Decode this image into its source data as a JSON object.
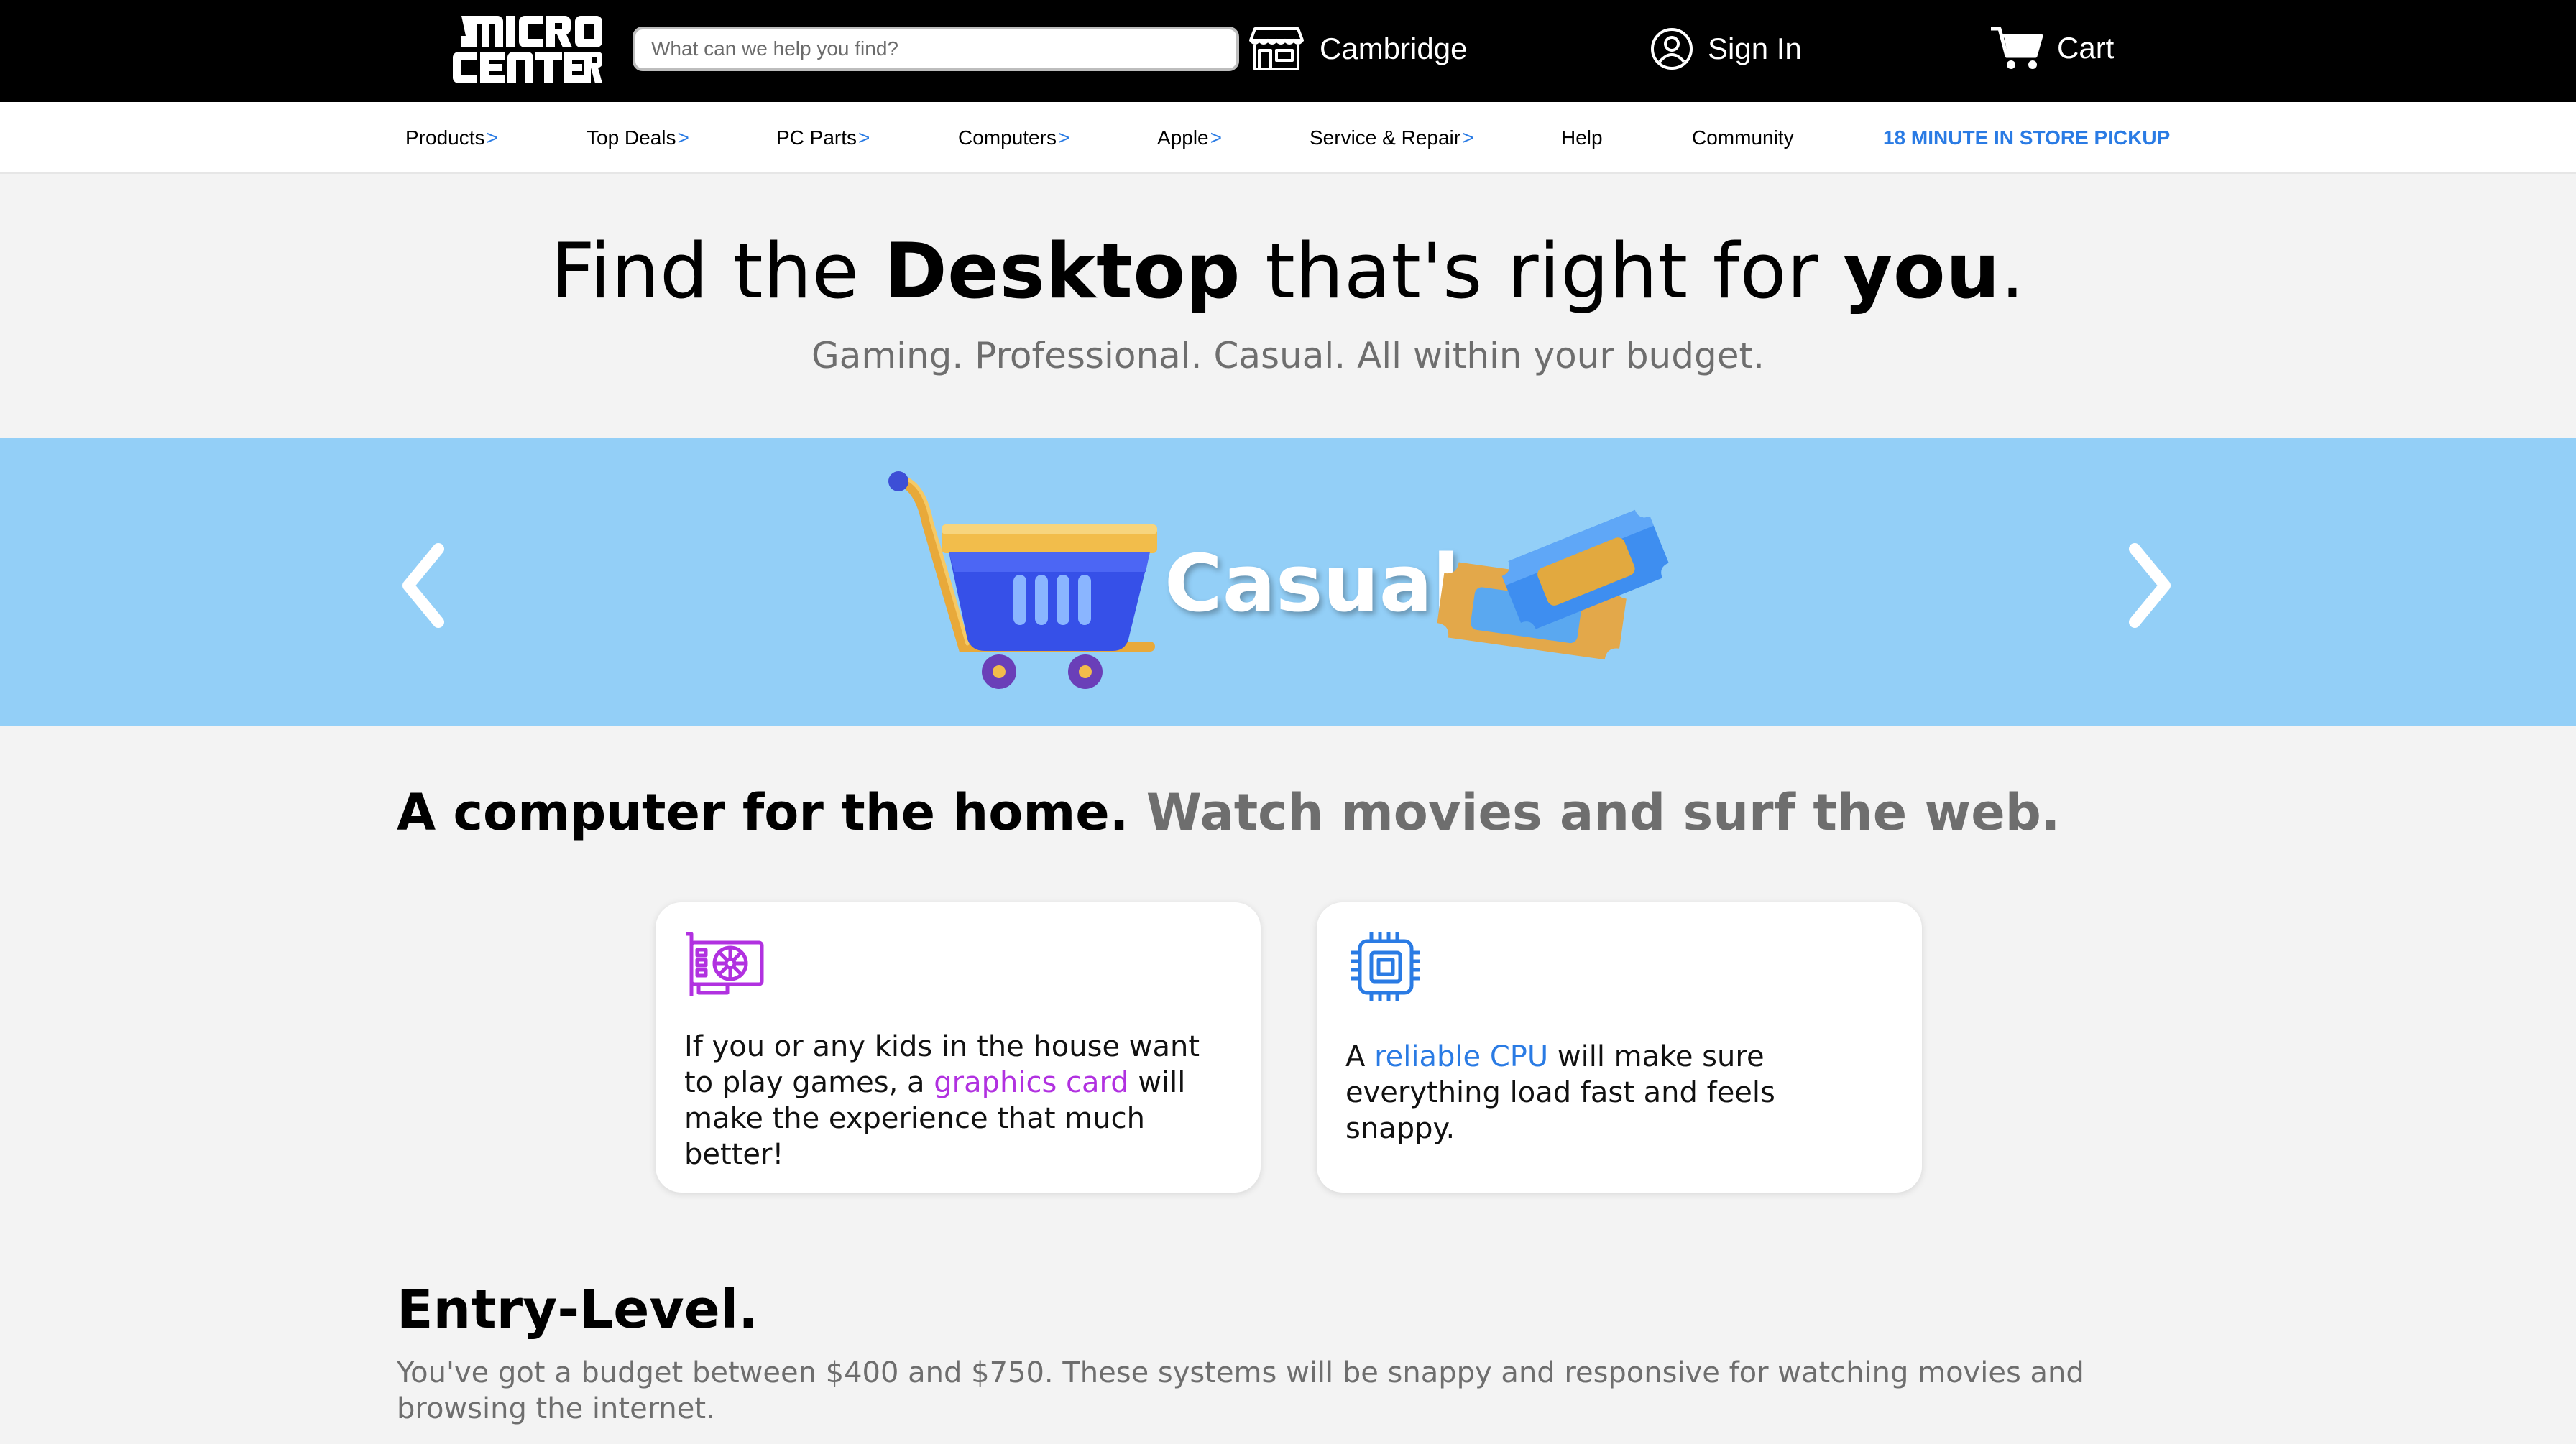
{
  "header": {
    "logo_text": "MICRO CENTER",
    "search_placeholder": "What can we help you find?",
    "store_label": "Cambridge",
    "signin_label": "Sign In",
    "cart_label": "Cart",
    "icons": [
      "store-icon",
      "user-icon",
      "cart-icon"
    ]
  },
  "nav": {
    "items": [
      {
        "label": "Products",
        "caret": ">"
      },
      {
        "label": "Top Deals",
        "caret": ">"
      },
      {
        "label": "PC Parts",
        "caret": ">"
      },
      {
        "label": "Computers",
        "caret": ">"
      },
      {
        "label": "Apple",
        "caret": ">"
      },
      {
        "label": "Service & Repair",
        "caret": ">"
      },
      {
        "label": "Help",
        "caret": ""
      },
      {
        "label": "Community",
        "caret": ""
      },
      {
        "label": "18 MINUTE IN STORE PICKUP",
        "caret": ""
      }
    ]
  },
  "hero": {
    "title_pre": "Find the ",
    "title_bold1": "Desktop",
    "title_mid": " that's right for ",
    "title_bold2": "you",
    "title_post": ".",
    "subtitle": "Gaming. Professional. Casual. All within your budget."
  },
  "banner": {
    "label": "Casual",
    "prev_icon": "chevron-left-icon",
    "next_icon": "chevron-right-icon",
    "bg_color": "#93cff7"
  },
  "section": {
    "head_main": "A computer for the home.",
    "head_muted": "Watch movies and surf the web.",
    "cards": [
      {
        "icon": "graphics-card-icon",
        "pre": "If you or any kids in the house want to play games, a ",
        "highlight": "graphics card",
        "post": " will make the experience that much better!"
      },
      {
        "icon": "cpu-icon",
        "pre": "A ",
        "highlight": "reliable CPU",
        "post": " will make sure everything load fast and feels snappy."
      }
    ]
  },
  "entry": {
    "title": "Entry-Level.",
    "description": "You've got a budget between $400 and $750. These systems will be snappy and responsive for watching movies and browsing the internet."
  },
  "colors": {
    "accent_blue": "#2a7be4",
    "accent_purple": "#b131e0",
    "topbar_bg": "#000000",
    "page_bg": "#f3f3f3"
  }
}
